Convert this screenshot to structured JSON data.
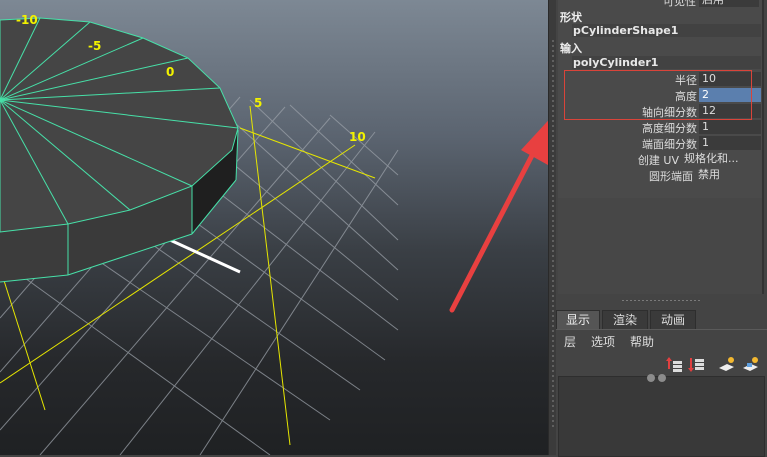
{
  "viewport": {
    "grid_labels": [
      "-10",
      "-5",
      "0",
      "5",
      "10"
    ],
    "colors": {
      "wire": "#47e0a8",
      "grid_axis": "#e6e600",
      "grid": "#9aa0a8",
      "cylinder": "#454545"
    }
  },
  "attribute_editor": {
    "top_row": {
      "label": "可见性",
      "value": "启用"
    },
    "shape_header": "形状",
    "shape_node": "pCylinderShape1",
    "inputs_header": "输入",
    "input_node": "polyCylinder1",
    "fields": [
      {
        "label": "半径",
        "value": "10"
      },
      {
        "label": "高度",
        "value": "2"
      },
      {
        "label": "轴向细分数",
        "value": "12"
      },
      {
        "label": "高度细分数",
        "value": "1"
      },
      {
        "label": "端面细分数",
        "value": "1"
      },
      {
        "label": "创建 UV",
        "value": "规格化和..."
      },
      {
        "label": "圆形端面",
        "value": "禁用"
      }
    ],
    "colors": {
      "highlight_border": "#d9443a",
      "selected_field": "#5b7fae"
    }
  },
  "annotation": {
    "arrow_color": "#e84040"
  },
  "layer_editor": {
    "tabs": [
      "显示",
      "渲染",
      "动画"
    ],
    "active_tab": "显示",
    "menu": [
      "层",
      "选项",
      "帮助"
    ],
    "tools": [
      "move-layer-up-icon",
      "move-layer-down-icon",
      "new-empty-layer-icon",
      "new-layer-from-selected-icon"
    ]
  }
}
